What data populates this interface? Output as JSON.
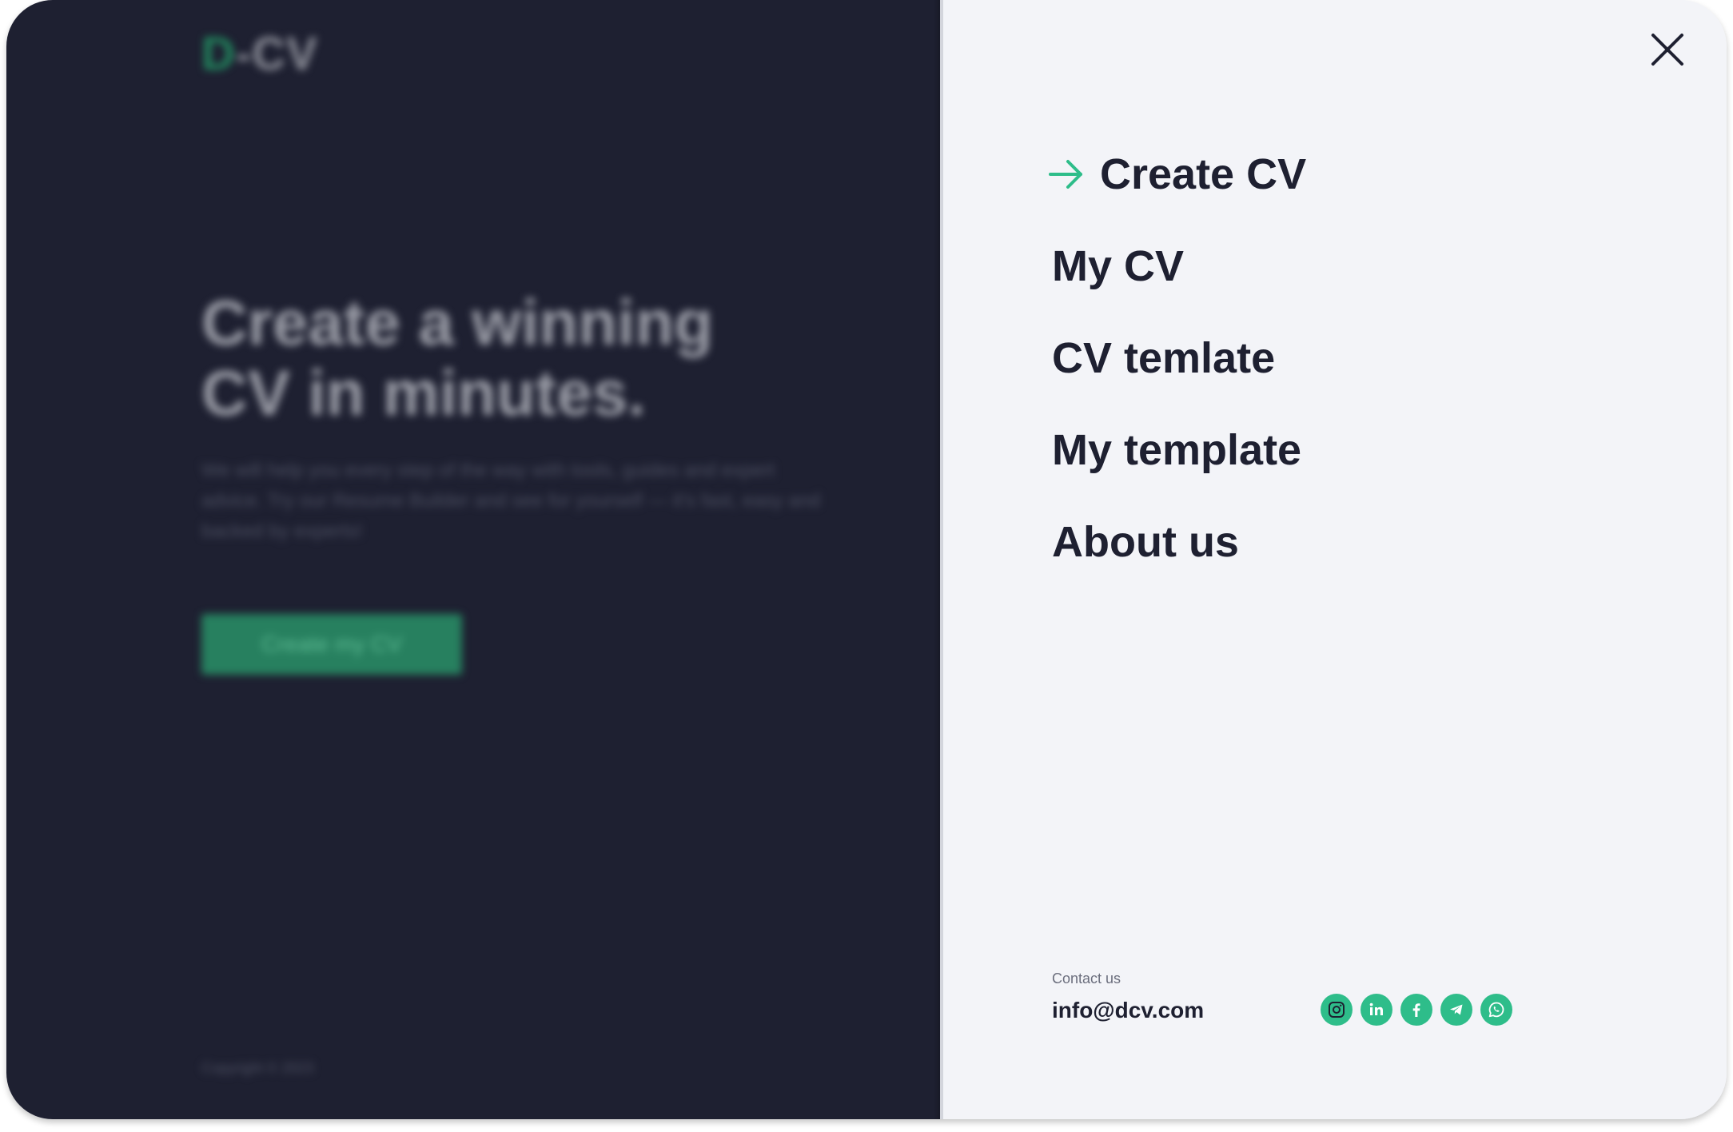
{
  "background_page": {
    "logo": {
      "accent": "D",
      "rest": "-CV"
    },
    "hero_title_line1": "Create a winning",
    "hero_title_line2": "CV in minutes.",
    "hero_text": "We will help you every step of the way with tools, guides and expert advice. Try our Resume Builder and see for yourself — it's fast, easy and backed by experts!",
    "cta_label": "Create my CV",
    "copyright": "Copyright © 2023"
  },
  "menu": {
    "items": [
      {
        "label": "Create CV",
        "active": true
      },
      {
        "label": "My CV"
      },
      {
        "label": "CV temlate"
      },
      {
        "label": "My template"
      },
      {
        "label": "About us"
      }
    ],
    "close_icon": "close-icon",
    "active_icon": "arrow-right-icon"
  },
  "contact": {
    "label": "Contact us",
    "email": "info@dcv.com",
    "socials": [
      "instagram-icon",
      "linkedin-icon",
      "facebook-icon",
      "telegram-icon",
      "whatsapp-icon"
    ]
  },
  "colors": {
    "accent": "#2ebd8a",
    "dark": "#1e2031",
    "panel_bg": "#f3f4f8"
  }
}
